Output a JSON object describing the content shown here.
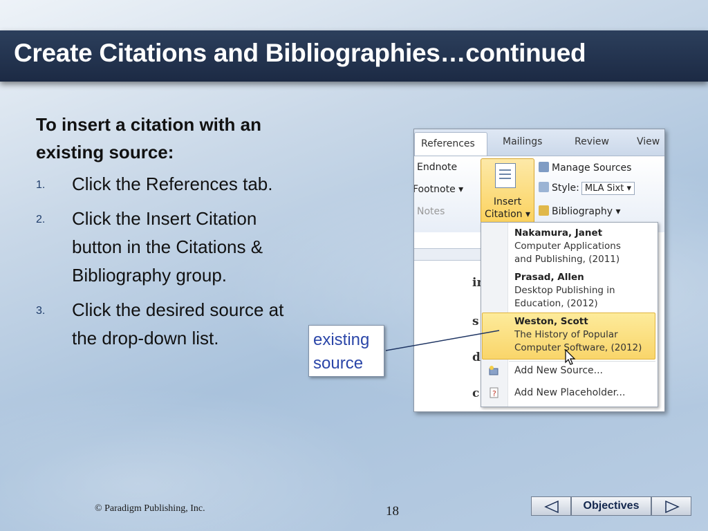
{
  "slide": {
    "title": "Create Citations and Bibliographies…continued",
    "lead": "To insert a citation with an existing source:",
    "steps": [
      {
        "num": "1.",
        "text": "Click the References tab."
      },
      {
        "num": "2.",
        "text": "Click the Insert Citation button in the Citations & Bibliography group."
      },
      {
        "num": "3.",
        "text": "Click the desired source at the drop-down list."
      }
    ]
  },
  "screenshot": {
    "tabs": [
      "References",
      "Mailings",
      "Review",
      "View"
    ],
    "ribbon": {
      "endnote": "Endnote",
      "footnote": "Footnote ▾",
      "notes": "Notes",
      "insert_citation_line1": "Insert",
      "insert_citation_line2": "Citation ▾",
      "manage_sources": "Manage Sources",
      "style_label": "Style:",
      "style_value": "MLA Sixt ▾",
      "bibliography": "Bibliography ▾"
    },
    "doc_letters": [
      "in",
      "s",
      "d",
      "c"
    ],
    "sources": [
      {
        "author": "Nakamura, Janet",
        "title_line1": "Computer Applications",
        "title_line2": "and Publishing, (2011)"
      },
      {
        "author": "Prasad, Allen",
        "title_line1": "Desktop Publishing in",
        "title_line2": "Education, (2012)"
      },
      {
        "author": "Weston, Scott",
        "title_line1": "The History of Popular",
        "title_line2": "Computer Software, (2012)"
      }
    ],
    "add_new_source": "Add New Source...",
    "add_new_placeholder": "Add New Placeholder..."
  },
  "callout": {
    "line1": "existing",
    "line2": "source"
  },
  "footer": {
    "copyright": "© Paradigm Publishing, Inc.",
    "page_number": "18",
    "objectives_label": "Objectives"
  },
  "colors": {
    "title_bar": "#1c2a44",
    "callout_text": "#2b46a8",
    "highlight": "#f9d56a"
  }
}
